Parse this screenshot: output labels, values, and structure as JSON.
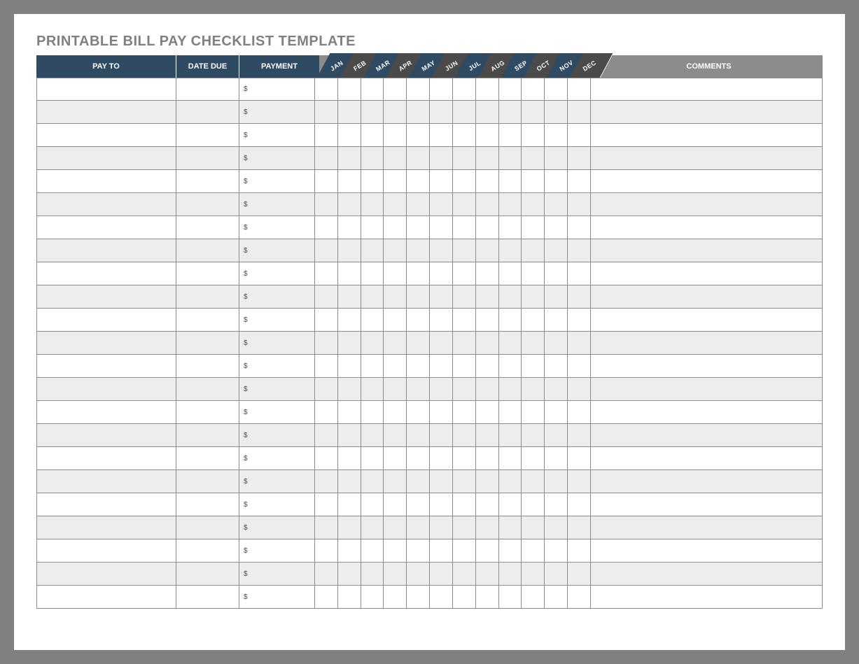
{
  "title": "PRINTABLE BILL PAY CHECKLIST TEMPLATE",
  "columns": {
    "pay_to": "PAY TO",
    "date_due": "DATE DUE",
    "payment": "PAYMENT",
    "comments": "COMMENTS"
  },
  "months": [
    "JAN",
    "FEB",
    "MAR",
    "APR",
    "MAY",
    "JUN",
    "JUL",
    "AUG",
    "SEP",
    "OCT",
    "NOV",
    "DEC"
  ],
  "currency_symbol": "$",
  "row_count": 23,
  "colors": {
    "header_blue": "#2f4a63",
    "header_grey": "#8c8c8c",
    "tab_dark": "#4a4a4a",
    "page_bg": "#808080",
    "row_alt": "#ededed"
  }
}
